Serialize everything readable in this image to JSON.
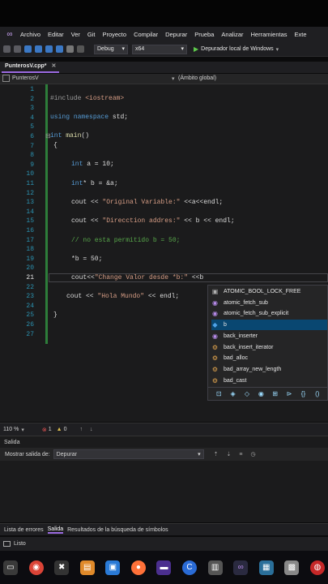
{
  "menu": {
    "items": [
      "Archivo",
      "Editar",
      "Ver",
      "Git",
      "Proyecto",
      "Compilar",
      "Depurar",
      "Prueba",
      "Analizar",
      "Herramientas",
      "Exte"
    ]
  },
  "toolbar": {
    "config": "Debug",
    "platform": "x64",
    "run_label": "Depurador local de Windows"
  },
  "tab": {
    "label": "PunterosV.cpp*"
  },
  "navbar": {
    "project": "PunterosV",
    "scope": "(Ámbito global)"
  },
  "editor": {
    "line_numbers": [
      "1",
      "2",
      "3",
      "4",
      "5",
      "6",
      "7",
      "8",
      "9",
      "10",
      "11",
      "12",
      "13",
      "14",
      "15",
      "16",
      "17",
      "18",
      "19",
      "20",
      "21",
      "22",
      "23",
      "24",
      "25",
      "26",
      "27"
    ],
    "lines": {
      "l2_pp": "#include ",
      "l2_inc": "<iostream>",
      "l4_kw1": "using",
      "l4_kw2": "namespace",
      "l4_rest": " std;",
      "l6_kw": "int",
      "l6_fn": " main",
      "l6_rest": "()",
      "l7": "{",
      "l10_kw": "int",
      "l10_rest": " a = 10;",
      "l12_kw": "int",
      "l12_rest": "* b = &a;",
      "l14_pre": "cout << ",
      "l14_str": "\"Original Variable:\"",
      "l14_post": " <<a<<endl;",
      "l16_pre": "cout << ",
      "l16_str": "\"Direcction addres:\"",
      "l16_post": " << b << endl;",
      "l18_cm": "// no esta permitido b = 50;",
      "l20": "*b = 50;",
      "l22_pre": "cout<<",
      "l22_str": "\"Change Valor desde *b:\"",
      "l22_post": " <<b",
      "l24_pre": "cout << ",
      "l24_str": "\"Hola Mundo\"",
      "l24_post": " << endl;",
      "l26": "}"
    }
  },
  "completion": {
    "items": [
      {
        "label": "ATOMIC_BOOL_LOCK_FREE",
        "icon": "macro-icon"
      },
      {
        "label": "atomic_fetch_sub",
        "icon": "function-icon"
      },
      {
        "label": "atomic_fetch_sub_explicit",
        "icon": "function-icon"
      },
      {
        "label": "b",
        "icon": "variable-icon"
      },
      {
        "label": "back_inserter",
        "icon": "function-icon"
      },
      {
        "label": "back_insert_iterator",
        "icon": "class-icon"
      },
      {
        "label": "bad_alloc",
        "icon": "class-icon"
      },
      {
        "label": "bad_array_new_length",
        "icon": "class-icon"
      },
      {
        "label": "bad_cast",
        "icon": "class-icon"
      }
    ],
    "selected_index": 3
  },
  "edstatus": {
    "zoom": "110 %",
    "errors": "1",
    "warnings": "0"
  },
  "output": {
    "title": "Salida",
    "show_label": "Mostrar salida de:",
    "source": "Depurar"
  },
  "bottomtabs": [
    "Lista de errores",
    "Salida",
    "Resultados de la búsqueda de símbolos"
  ],
  "status": {
    "text": "Listo"
  },
  "colors": {
    "accent": "#9b6ae0",
    "keyword": "#569cd6",
    "string": "#d69d85",
    "comment": "#57a64a",
    "linenum": "#2b91af",
    "selection": "#094771"
  }
}
